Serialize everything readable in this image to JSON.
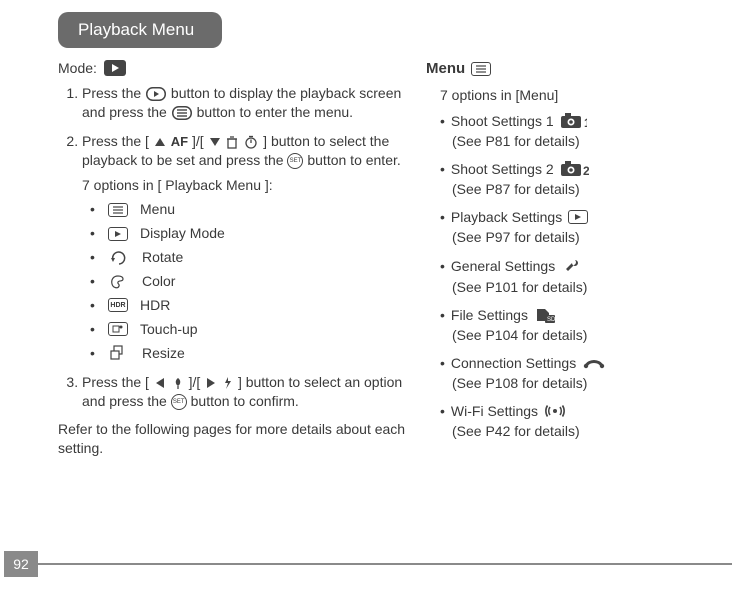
{
  "tab_title": "Playback Menu",
  "page_number": "92",
  "left": {
    "mode_label": "Mode:",
    "step1_a": "Press the ",
    "step1_b": " button to display the playback screen and press the ",
    "step1_c": " button to enter the menu.",
    "step2_a": "Press the [ ",
    "step2_mid": " ]/[ ",
    "step2_b": " ] button to select the playback to be set and press the ",
    "step2_c": " button to enter.",
    "options_title": "7 options in [ Playback Menu ]:",
    "opts": {
      "menu": "Menu",
      "display": "Display Mode",
      "rotate": "Rotate",
      "color": "Color",
      "hdr": "HDR",
      "touchup": "Touch-up",
      "resize": "Resize"
    },
    "step3_a": "Press the [ ",
    "step3_mid": " ]/[ ",
    "step3_b": " ] button to select an option and press the ",
    "step3_c": " button to confirm.",
    "refer": "Refer to the following pages for more details about each setting."
  },
  "right": {
    "menu_head": "Menu",
    "count": "7 options in [Menu]",
    "items": [
      {
        "label": "Shoot Settings 1",
        "sub": "(See P81 for details)"
      },
      {
        "label": "Shoot Settings 2",
        "sub": "(See P87 for details)"
      },
      {
        "label": "Playback Settings",
        "sub": "(See P97 for details)"
      },
      {
        "label": "General Settings",
        "sub": "(See P101 for details)"
      },
      {
        "label": "File Settings",
        "sub": "(See P104 for details)"
      },
      {
        "label": "Connection Settings",
        "sub": "(See P108 for details)"
      },
      {
        "label": "Wi-Fi Settings",
        "sub": "(See P42 for details)"
      }
    ],
    "af_label": "AF",
    "set_label": "SET",
    "hdr_label": "HDR"
  }
}
